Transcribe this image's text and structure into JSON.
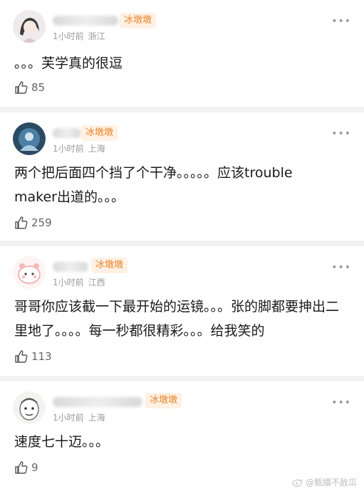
{
  "comments": [
    {
      "badge": "冰墩墩",
      "time": "1小时前",
      "location": "浙江",
      "text": "。。。芙学真的很逗",
      "likes": "85"
    },
    {
      "badge": "冰墩墩",
      "time": "1小时前",
      "location": "上海",
      "text": "两个把后面四个挡了个干净。。。。。应该trouble maker出道的。。。",
      "likes": "259"
    },
    {
      "badge": "冰墩墩",
      "time": "1小时前",
      "location": "江西",
      "text": "哥哥你应该截一下最开始的运镜。。。张的脚都要抻出二里地了。。。。每一秒都很精彩。。。给我笑的",
      "likes": "113"
    },
    {
      "badge": "冰墩墩",
      "time": "1小时前",
      "location": "上海",
      "text": "速度七十迈。。。",
      "likes": "9"
    }
  ],
  "more_label": "•••",
  "watermark": "@甄嬛不敌瓜",
  "colors": {
    "badge": "#e8832a",
    "badge_bg": "#fff1e4",
    "divider": "#f2f2f2",
    "meta": "#9a9a9a"
  },
  "icons": {
    "like": "thumbs-up-icon",
    "more": "more-dots-icon",
    "logo": "weibo-logo-icon"
  }
}
